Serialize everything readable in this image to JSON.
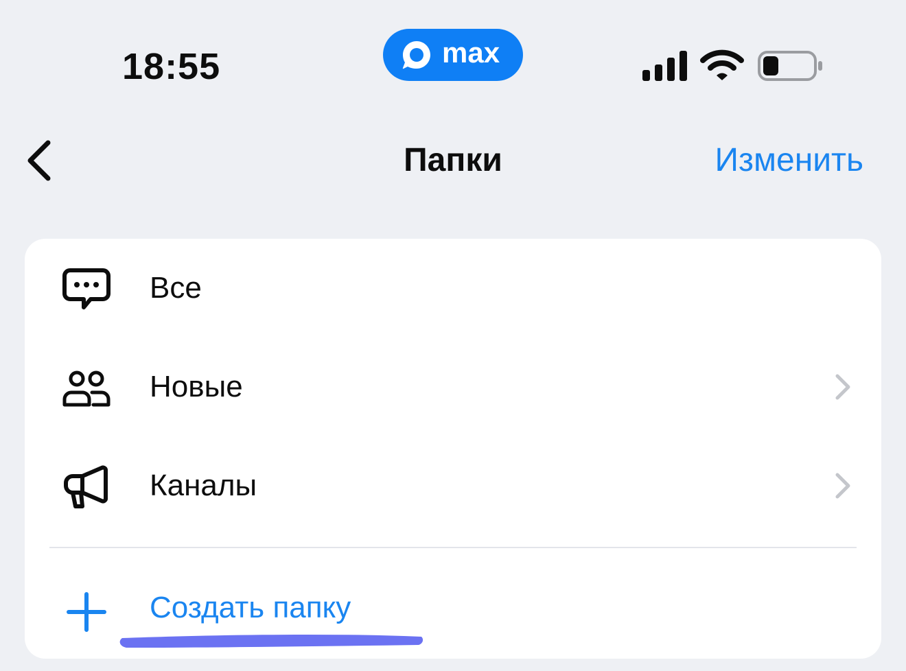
{
  "status_bar": {
    "time": "18:55",
    "app_badge": "max",
    "icons": [
      "signal-icon",
      "wifi-icon",
      "battery-icon"
    ]
  },
  "nav": {
    "back_icon": "chevron-left-icon",
    "title": "Папки",
    "edit_label": "Изменить"
  },
  "folders": [
    {
      "label": "Все",
      "icon": "chat-bubble-dots-icon",
      "has_chevron": false
    },
    {
      "label": "Новые",
      "icon": "people-icon",
      "has_chevron": true
    },
    {
      "label": "Каналы",
      "icon": "megaphone-icon",
      "has_chevron": true
    }
  ],
  "create_folder": {
    "label": "Создать папку",
    "icon": "plus-icon"
  },
  "colors": {
    "background": "#eef0f4",
    "card": "#ffffff",
    "accent": "#1a85f0",
    "brand_pill": "#0f7ff5",
    "chevron": "#c4c6cb",
    "highlight_underline": "#6b72f2"
  }
}
